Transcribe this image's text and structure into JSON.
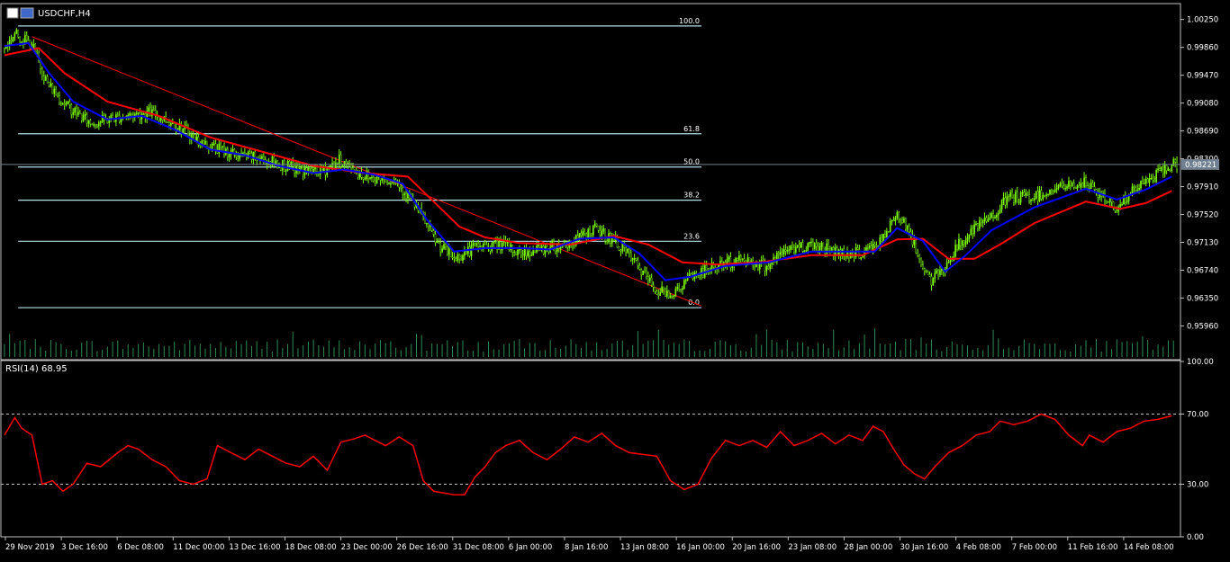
{
  "window": {
    "title": "USDCHF,H4"
  },
  "colors": {
    "background": "#000000",
    "frame": "#c0c0c0",
    "candle_up": "#7fff00",
    "candle_down": "#7fff00",
    "fast_ma": "#0000ff",
    "slow_ma": "#ff0000",
    "fib": "#b0e0e6",
    "trendline": "#ff0000",
    "rsi": "#ff0000",
    "volume": "#2e8b57"
  },
  "chart_data": [
    {
      "type": "candlestick",
      "title": "USDCHF,H4",
      "ylim": [
        0.95525,
        1.00435
      ],
      "y_ticks": [
        "1.00250",
        "0.99860",
        "0.99470",
        "0.99080",
        "0.98690",
        "0.98300",
        "0.97910",
        "0.97520",
        "0.97130",
        "0.96740",
        "0.96350",
        "0.95960"
      ],
      "current_price": "0.98221",
      "x_labels": [
        "29 Nov 2019",
        "3 Dec 16:00",
        "6 Dec 08:00",
        "11 Dec 00:00",
        "13 Dec 16:00",
        "18 Dec 08:00",
        "23 Dec 00:00",
        "26 Dec 16:00",
        "31 Dec 08:00",
        "6 Jan 00:00",
        "8 Jan 16:00",
        "13 Jan 08:00",
        "16 Jan 00:00",
        "20 Jan 16:00",
        "23 Jan 08:00",
        "28 Jan 00:00",
        "30 Jan 16:00",
        "4 Feb 08:00",
        "7 Feb 00:00",
        "11 Feb 16:00",
        "14 Feb 08:00"
      ],
      "price_path": [
        [
          0,
          0.9985
        ],
        [
          6,
          1.0005
        ],
        [
          16,
          0.999
        ],
        [
          25,
          0.9935
        ],
        [
          36,
          0.9905
        ],
        [
          50,
          0.988
        ],
        [
          70,
          0.989
        ],
        [
          85,
          0.9895
        ],
        [
          100,
          0.9878
        ],
        [
          115,
          0.9852
        ],
        [
          135,
          0.9835
        ],
        [
          150,
          0.983
        ],
        [
          170,
          0.9815
        ],
        [
          185,
          0.9812
        ],
        [
          195,
          0.9828
        ],
        [
          210,
          0.9805
        ],
        [
          228,
          0.98
        ],
        [
          240,
          0.9762
        ],
        [
          252,
          0.9712
        ],
        [
          262,
          0.969
        ],
        [
          275,
          0.9707
        ],
        [
          290,
          0.971
        ],
        [
          300,
          0.9698
        ],
        [
          315,
          0.9705
        ],
        [
          330,
          0.9712
        ],
        [
          344,
          0.9732
        ],
        [
          357,
          0.9712
        ],
        [
          366,
          0.9688
        ],
        [
          380,
          0.9645
        ],
        [
          390,
          0.9642
        ],
        [
          400,
          0.9665
        ],
        [
          415,
          0.968
        ],
        [
          430,
          0.969
        ],
        [
          444,
          0.968
        ],
        [
          457,
          0.9705
        ],
        [
          472,
          0.971
        ],
        [
          487,
          0.9698
        ],
        [
          500,
          0.9698
        ],
        [
          512,
          0.9717
        ],
        [
          520,
          0.9755
        ],
        [
          526,
          0.9735
        ],
        [
          532,
          0.9695
        ],
        [
          540,
          0.9658
        ],
        [
          548,
          0.968
        ],
        [
          556,
          0.971
        ],
        [
          565,
          0.973
        ],
        [
          575,
          0.975
        ],
        [
          585,
          0.9775
        ],
        [
          600,
          0.9777
        ],
        [
          615,
          0.979
        ],
        [
          630,
          0.9796
        ],
        [
          640,
          0.9775
        ],
        [
          648,
          0.9762
        ],
        [
          660,
          0.979
        ],
        [
          670,
          0.9806
        ],
        [
          680,
          0.9822
        ]
      ],
      "fast_ma_path": [
        [
          0,
          0.9988
        ],
        [
          14,
          0.9992
        ],
        [
          26,
          0.995
        ],
        [
          40,
          0.991
        ],
        [
          60,
          0.9885
        ],
        [
          80,
          0.989
        ],
        [
          100,
          0.987
        ],
        [
          120,
          0.9843
        ],
        [
          140,
          0.9835
        ],
        [
          160,
          0.982
        ],
        [
          180,
          0.981
        ],
        [
          198,
          0.9815
        ],
        [
          215,
          0.9808
        ],
        [
          232,
          0.9795
        ],
        [
          246,
          0.9745
        ],
        [
          262,
          0.97
        ],
        [
          280,
          0.9705
        ],
        [
          300,
          0.9705
        ],
        [
          318,
          0.9703
        ],
        [
          335,
          0.9718
        ],
        [
          355,
          0.972
        ],
        [
          370,
          0.9697
        ],
        [
          385,
          0.966
        ],
        [
          400,
          0.9665
        ],
        [
          420,
          0.968
        ],
        [
          445,
          0.9685
        ],
        [
          470,
          0.97
        ],
        [
          490,
          0.97
        ],
        [
          507,
          0.97
        ],
        [
          520,
          0.9733
        ],
        [
          535,
          0.9715
        ],
        [
          548,
          0.9672
        ],
        [
          560,
          0.9695
        ],
        [
          575,
          0.973
        ],
        [
          600,
          0.9762
        ],
        [
          630,
          0.9788
        ],
        [
          648,
          0.9773
        ],
        [
          665,
          0.9787
        ],
        [
          680,
          0.9805
        ]
      ],
      "slow_ma_path": [
        [
          0,
          0.9975
        ],
        [
          20,
          0.9985
        ],
        [
          35,
          0.995
        ],
        [
          60,
          0.991
        ],
        [
          90,
          0.989
        ],
        [
          120,
          0.986
        ],
        [
          150,
          0.984
        ],
        [
          180,
          0.982
        ],
        [
          210,
          0.981
        ],
        [
          235,
          0.9805
        ],
        [
          250,
          0.977
        ],
        [
          265,
          0.9735
        ],
        [
          280,
          0.972
        ],
        [
          300,
          0.9712
        ],
        [
          330,
          0.971
        ],
        [
          355,
          0.9722
        ],
        [
          375,
          0.971
        ],
        [
          395,
          0.9685
        ],
        [
          415,
          0.9682
        ],
        [
          440,
          0.9685
        ],
        [
          470,
          0.9695
        ],
        [
          500,
          0.9695
        ],
        [
          520,
          0.9717
        ],
        [
          535,
          0.9718
        ],
        [
          550,
          0.969
        ],
        [
          565,
          0.969
        ],
        [
          580,
          0.971
        ],
        [
          600,
          0.974
        ],
        [
          630,
          0.977
        ],
        [
          650,
          0.976
        ],
        [
          665,
          0.9768
        ],
        [
          680,
          0.9785
        ]
      ],
      "fibonacci": {
        "levels": [
          {
            "label": "100.0",
            "price": 1.0016
          },
          {
            "label": "61.8",
            "price": 0.9865
          },
          {
            "label": "50.0",
            "price": 0.98185
          },
          {
            "label": "38.2",
            "price": 0.9772
          },
          {
            "label": "23.6",
            "price": 0.97145
          },
          {
            "label": "0.0",
            "price": 0.96215
          }
        ],
        "x_start": 8,
        "x_end": 406
      },
      "trendline": [
        [
          16,
          1.0001
        ],
        [
          406,
          0.9624
        ]
      ]
    },
    {
      "type": "line",
      "title": "RSI(14) 68.95",
      "ylim": [
        0,
        100
      ],
      "y_ticks": [
        "100.00",
        "70.00",
        "30.00",
        "0.00"
      ],
      "levels": [
        70,
        30
      ],
      "series": [
        {
          "name": "RSI(14)",
          "points": [
            [
              0,
              58
            ],
            [
              6,
              68
            ],
            [
              10,
              62
            ],
            [
              16,
              58
            ],
            [
              22,
              30
            ],
            [
              28,
              32
            ],
            [
              34,
              26
            ],
            [
              40,
              30
            ],
            [
              48,
              42
            ],
            [
              56,
              40
            ],
            [
              66,
              48
            ],
            [
              72,
              52
            ],
            [
              78,
              50
            ],
            [
              86,
              44
            ],
            [
              94,
              40
            ],
            [
              102,
              32
            ],
            [
              110,
              30
            ],
            [
              118,
              33
            ],
            [
              124,
              52
            ],
            [
              132,
              48
            ],
            [
              140,
              44
            ],
            [
              148,
              50
            ],
            [
              156,
              46
            ],
            [
              164,
              42
            ],
            [
              172,
              40
            ],
            [
              180,
              46
            ],
            [
              188,
              38
            ],
            [
              196,
              54
            ],
            [
              204,
              56
            ],
            [
              210,
              58
            ],
            [
              216,
              55
            ],
            [
              222,
              52
            ],
            [
              230,
              57
            ],
            [
              238,
              52
            ],
            [
              244,
              32
            ],
            [
              250,
              26
            ],
            [
              256,
              25
            ],
            [
              262,
              24
            ],
            [
              268,
              24
            ],
            [
              274,
              34
            ],
            [
              280,
              40
            ],
            [
              286,
              48
            ],
            [
              292,
              52
            ],
            [
              300,
              55
            ],
            [
              308,
              48
            ],
            [
              316,
              44
            ],
            [
              324,
              50
            ],
            [
              332,
              57
            ],
            [
              340,
              54
            ],
            [
              348,
              59
            ],
            [
              356,
              52
            ],
            [
              364,
              48
            ],
            [
              372,
              47
            ],
            [
              380,
              46
            ],
            [
              388,
              32
            ],
            [
              396,
              27
            ],
            [
              404,
              30
            ],
            [
              412,
              45
            ],
            [
              420,
              55
            ],
            [
              428,
              52
            ],
            [
              436,
              55
            ],
            [
              444,
              51
            ],
            [
              452,
              60
            ],
            [
              460,
              52
            ],
            [
              468,
              55
            ],
            [
              476,
              59
            ],
            [
              484,
              53
            ],
            [
              492,
              58
            ],
            [
              500,
              55
            ],
            [
              506,
              63
            ],
            [
              512,
              60
            ],
            [
              518,
              50
            ],
            [
              524,
              41
            ],
            [
              530,
              36
            ],
            [
              536,
              33
            ],
            [
              542,
              40
            ],
            [
              550,
              48
            ],
            [
              558,
              52
            ],
            [
              566,
              58
            ],
            [
              574,
              60
            ],
            [
              580,
              66
            ],
            [
              588,
              64
            ],
            [
              596,
              66
            ],
            [
              604,
              70
            ],
            [
              612,
              67
            ],
            [
              620,
              58
            ],
            [
              628,
              52
            ],
            [
              632,
              58
            ],
            [
              640,
              54
            ],
            [
              648,
              60
            ],
            [
              656,
              62
            ],
            [
              664,
              66
            ],
            [
              672,
              67
            ],
            [
              680,
              69
            ]
          ]
        }
      ]
    }
  ]
}
